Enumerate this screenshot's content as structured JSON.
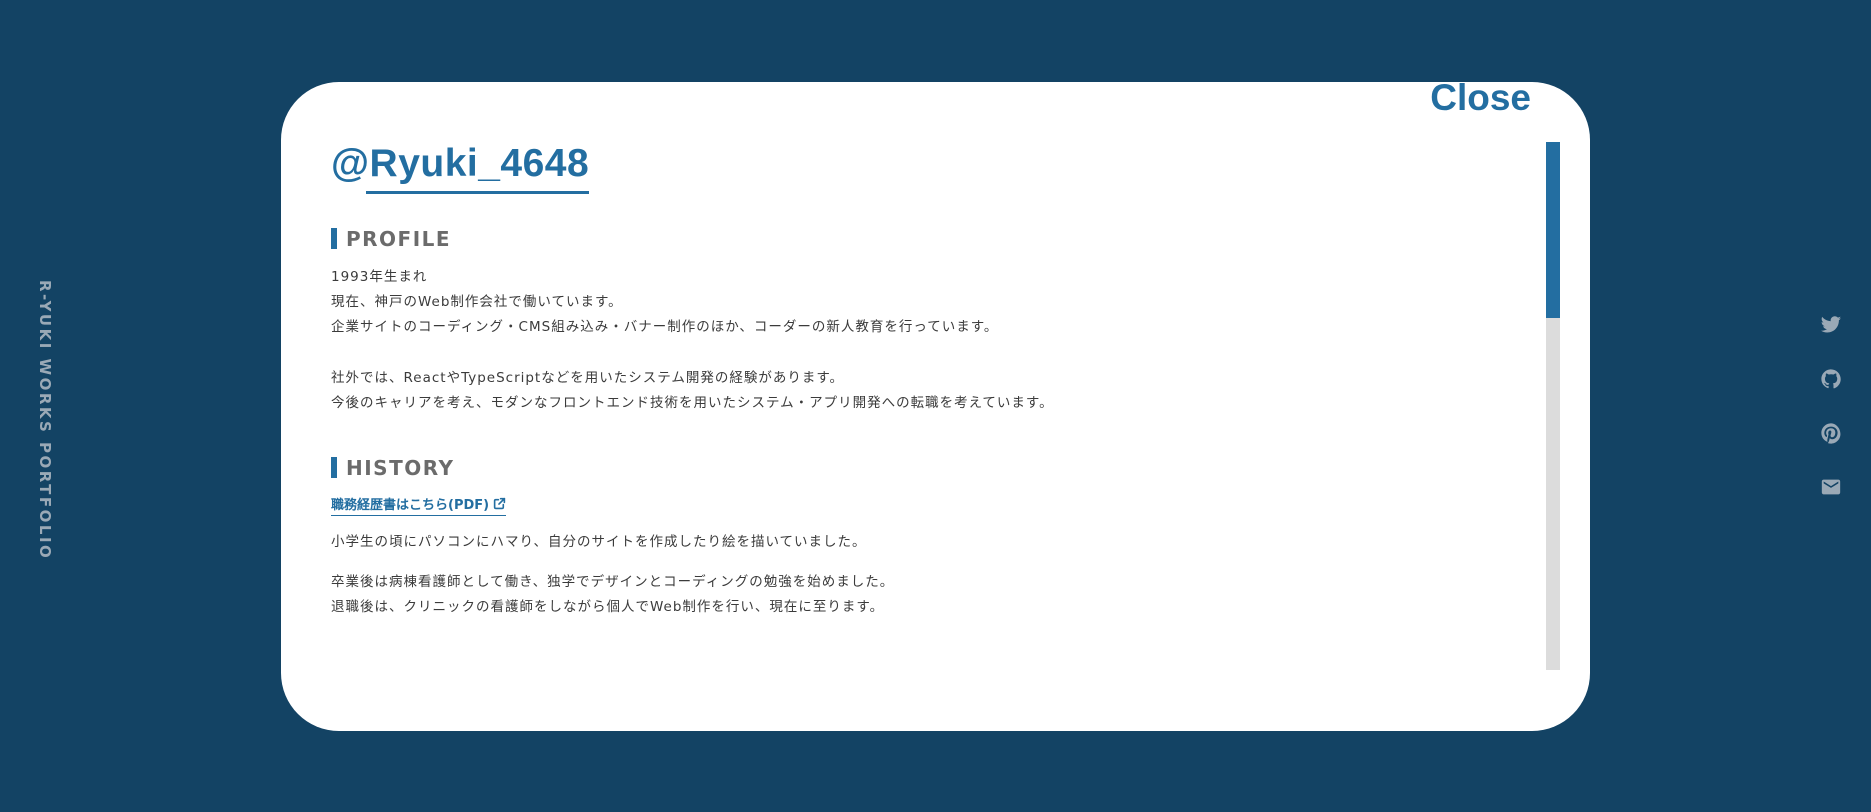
{
  "brand": {
    "vertical_text": "R-YUKI WORKS PORTFOLIO"
  },
  "social": [
    {
      "icon": "twitter-icon"
    },
    {
      "icon": "github-icon"
    },
    {
      "icon": "pinterest-icon"
    },
    {
      "icon": "mail-icon"
    }
  ],
  "modal": {
    "close_label": "Close",
    "handle": "@Ryuki_4648",
    "profile": {
      "title": "PROFILE",
      "lines": [
        "1993年生まれ",
        "現在、神戸のWeb制作会社で働いています。",
        "企業サイトのコーディング・CMS組み込み・バナー制作のほか、コーダーの新人教育を行っています。"
      ],
      "lines2": [
        "社外では、ReactやTypeScriptなどを用いたシステム開発の経験があります。",
        "今後のキャリアを考え、モダンなフロントエンド技術を用いたシステム・アプリ開発への転職を考えています。"
      ]
    },
    "history": {
      "title": "HISTORY",
      "pdf_link": "職務経歴書はこちら(PDF)",
      "p1": "小学生の頃にパソコンにハマり、自分のサイトを作成したり絵を描いていました。",
      "p2": [
        "卒業後は病棟看護師として働き、独学でデザインとコーディングの勉強を始めました。",
        "退職後は、クリニックの看護師をしながら個人でWeb制作を行い、現在に至ります。"
      ]
    }
  },
  "colors": {
    "background": "#134364",
    "accent": "#236ea1",
    "muted_icon": "#9aa9b6",
    "scroll_track": "#dcdcdc"
  }
}
